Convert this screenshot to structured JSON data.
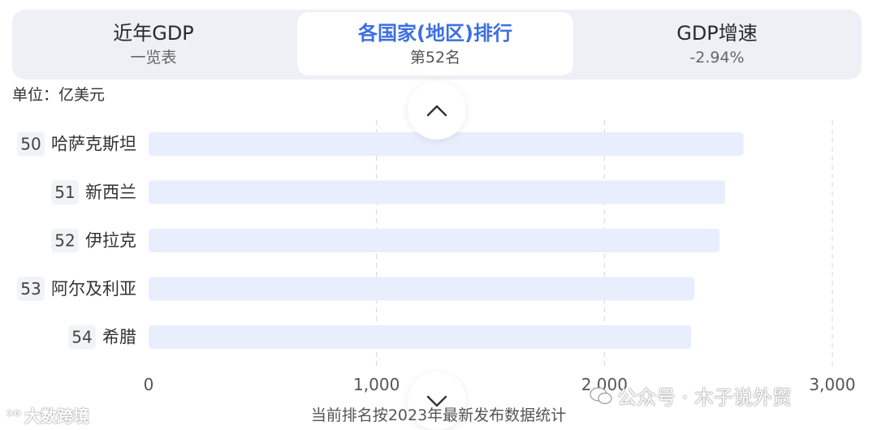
{
  "tabs": [
    {
      "title": "近年GDP",
      "subtitle": "一览表",
      "active": false
    },
    {
      "title": "各国家(地区)排行",
      "subtitle": "第52名",
      "active": true
    },
    {
      "title": "GDP增速",
      "subtitle": "-2.94%",
      "active": false
    }
  ],
  "unit_label": "单位：亿美元",
  "footnote": "当前排名按2023年最新发布数据统计",
  "watermarks": {
    "left": "大数跨境",
    "right": "公众号 · 木子说外贸"
  },
  "colors": {
    "accent": "#3d6fe0",
    "bar": "#e8eefc",
    "rank_bg": "#f2f3f6",
    "grid": "#d0d4dc"
  },
  "icons": {
    "scroll_up": "chevron-up-icon",
    "scroll_down": "chevron-down-icon"
  },
  "chart_data": {
    "type": "bar",
    "orientation": "horizontal",
    "categories": [
      "哈萨克斯坦",
      "新西兰",
      "伊拉克",
      "阿尔及利亚",
      "希腊"
    ],
    "ranks": [
      "50",
      "51",
      "52",
      "53",
      "54"
    ],
    "values": [
      2610,
      2530,
      2505,
      2395,
      2380
    ],
    "xlim": [
      0,
      3000
    ],
    "xticks": [
      0,
      1000,
      2000,
      3000
    ],
    "xtick_labels": [
      "0",
      "1,000",
      "2,000",
      "3,000"
    ],
    "grid": true,
    "grid_style": "dashed vertical"
  }
}
